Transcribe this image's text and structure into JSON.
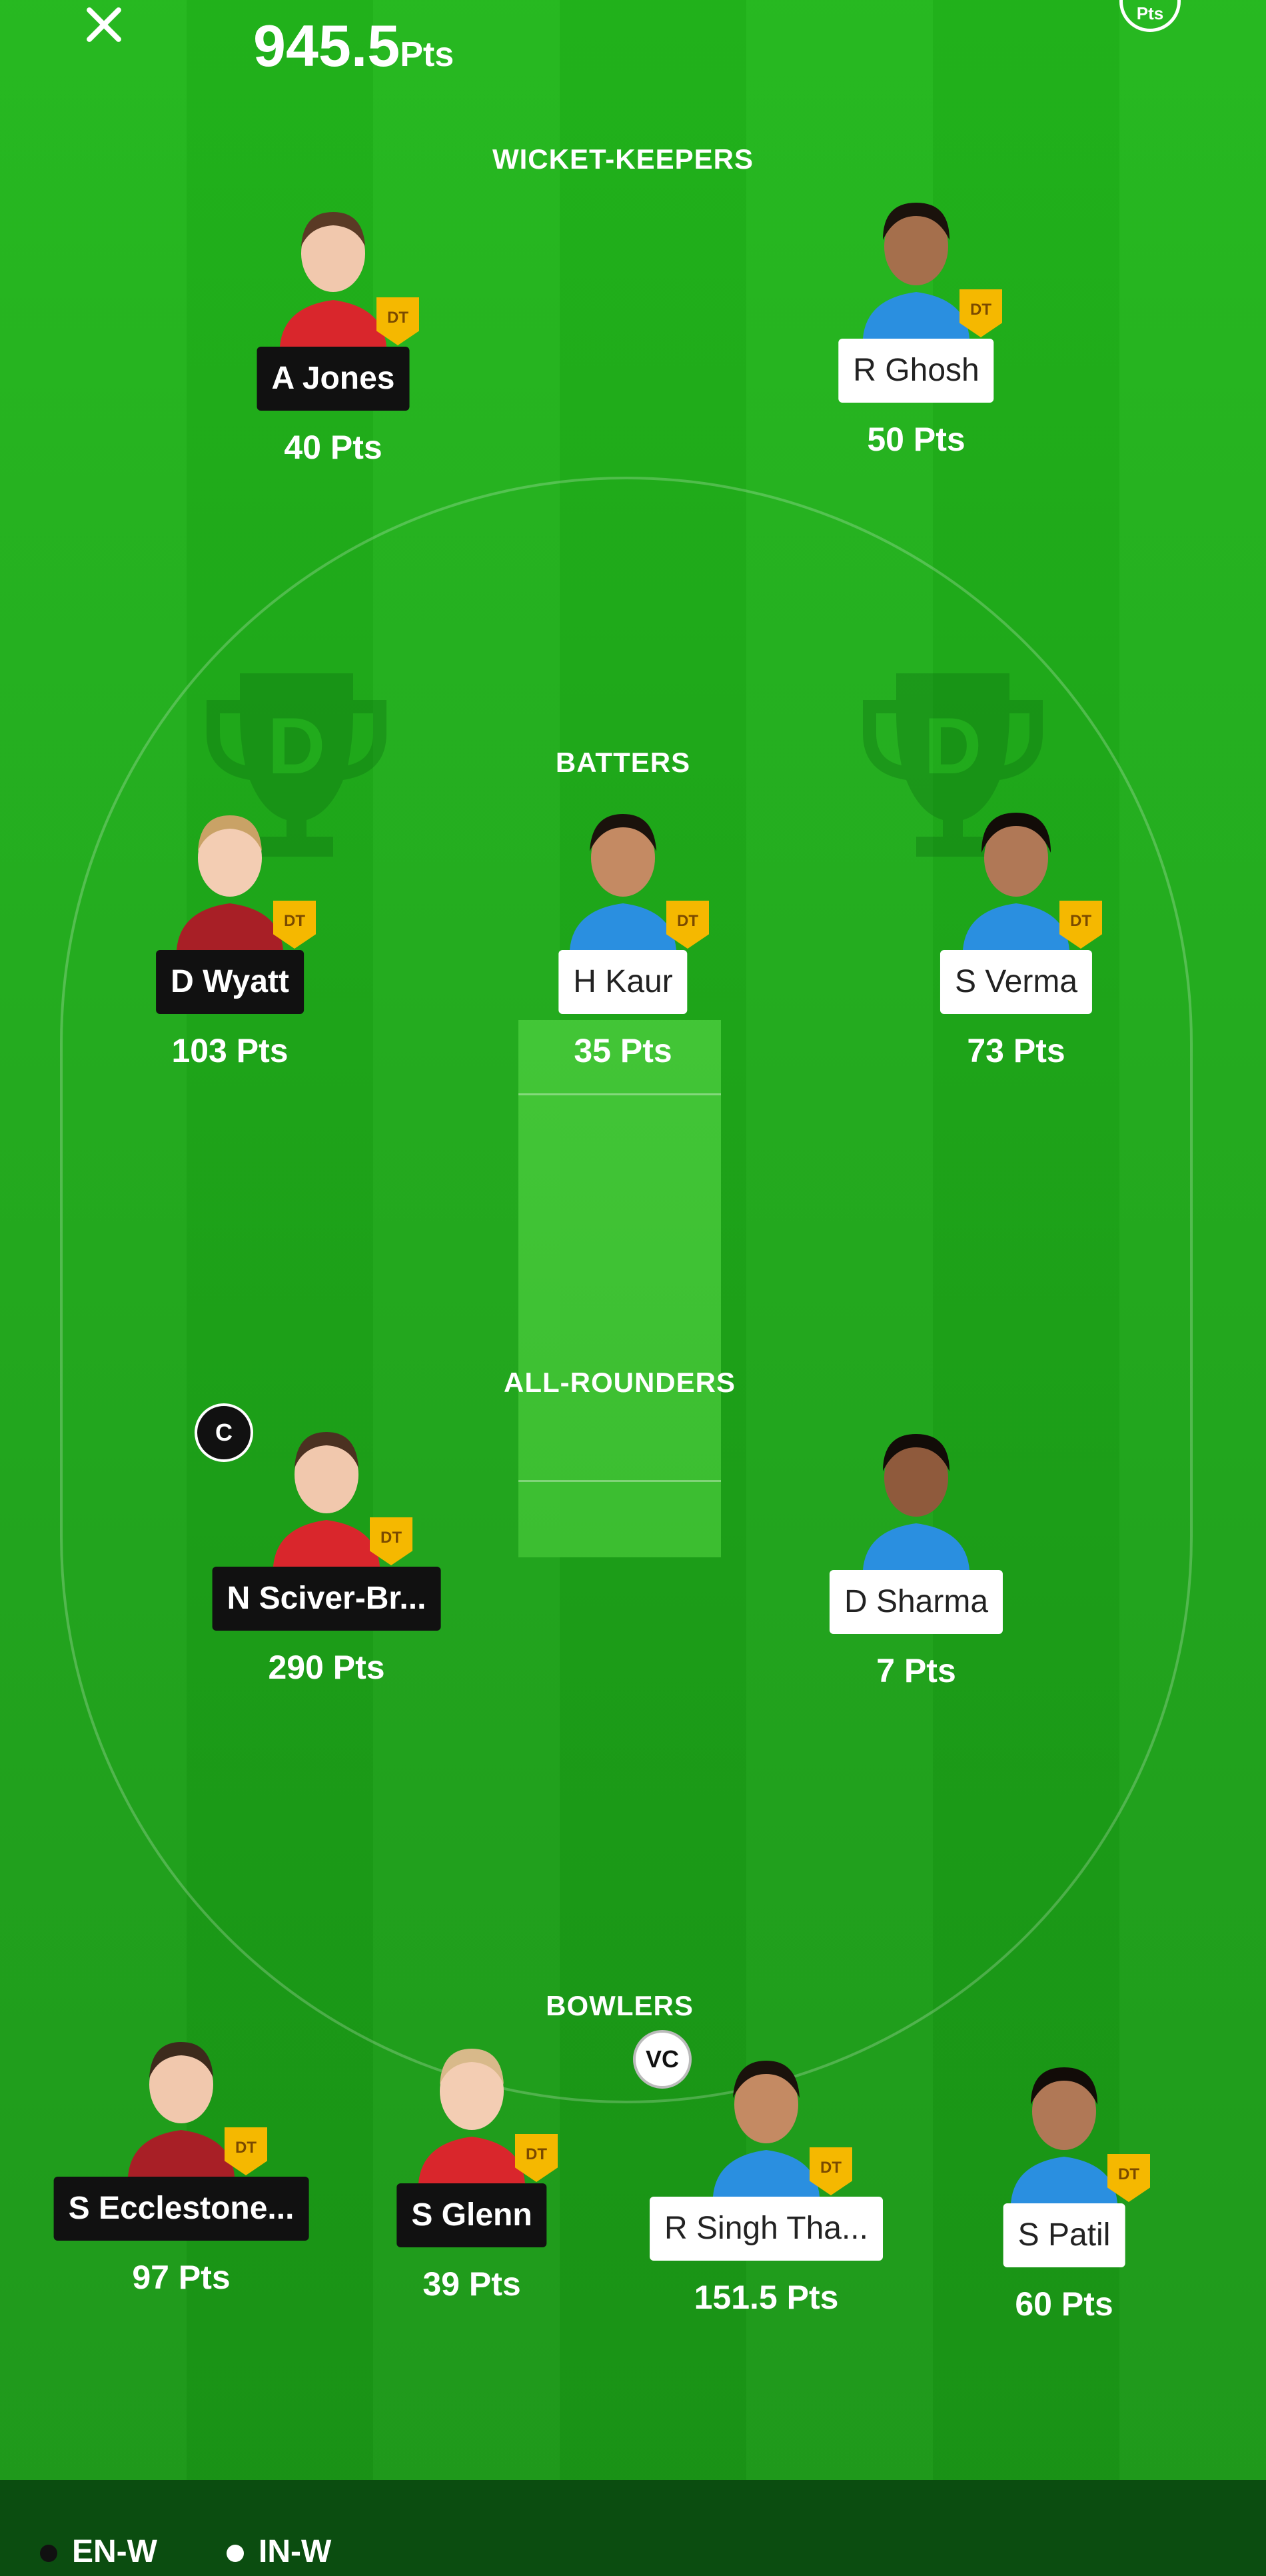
{
  "header": {
    "total_points": "945.5",
    "total_points_unit": "Pts",
    "pts_toggle_label": "Pts"
  },
  "sections": {
    "wicket_keepers": "WICKET-KEEPERS",
    "batters": "BATTERS",
    "all_rounders": "ALL-ROUNDERS",
    "bowlers": "BOWLERS"
  },
  "badges": {
    "dt": "DT",
    "captain": "C",
    "vice_captain": "VC"
  },
  "players": {
    "wk1": {
      "name": "A Jones",
      "points": "40 Pts",
      "team": "EN-W"
    },
    "wk2": {
      "name": "R Ghosh",
      "points": "50 Pts",
      "team": "IN-W"
    },
    "bat1": {
      "name": "D Wyatt",
      "points": "103 Pts",
      "team": "EN-W"
    },
    "bat2": {
      "name": "H Kaur",
      "points": "35 Pts",
      "team": "IN-W"
    },
    "bat3": {
      "name": "S Verma",
      "points": "73 Pts",
      "team": "IN-W"
    },
    "ar1": {
      "name": "N Sciver-Br...",
      "points": "290 Pts",
      "team": "EN-W"
    },
    "ar2": {
      "name": "D Sharma",
      "points": "7 Pts",
      "team": "IN-W"
    },
    "bowl1": {
      "name": "S Ecclestone...",
      "points": "97 Pts",
      "team": "EN-W"
    },
    "bowl2": {
      "name": "S Glenn",
      "points": "39 Pts",
      "team": "EN-W"
    },
    "bowl3": {
      "name": "R Singh Tha...",
      "points": "151.5 Pts",
      "team": "IN-W"
    },
    "bowl4": {
      "name": "S Patil",
      "points": "60 Pts",
      "team": "IN-W"
    }
  },
  "legend": {
    "team1": "EN-W",
    "team2": "IN-W"
  },
  "colors": {
    "field_green": "#22b71c",
    "team1_shirt": "#d9262c",
    "team2_shirt": "#2a8fe0",
    "dt_badge": "#f5b800"
  }
}
